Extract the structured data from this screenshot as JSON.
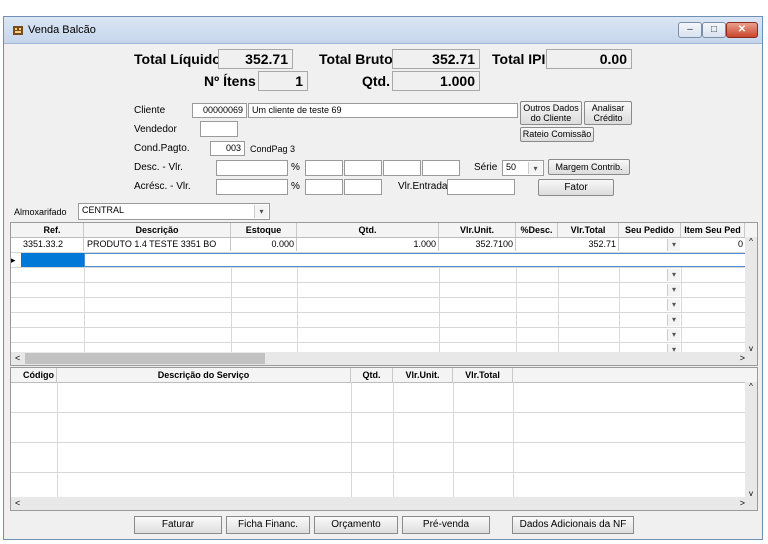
{
  "window": {
    "title": "Venda Balcão"
  },
  "totals": {
    "liquido_label": "Total Líquido",
    "liquido_value": "352.71",
    "bruto_label": "Total Bruto",
    "bruto_value": "352.71",
    "ipi_label": "Total IPI",
    "ipi_value": "0.00",
    "itens_label": "Nº Ítens",
    "itens_value": "1",
    "qtd_label": "Qtd.",
    "qtd_value": "1.000"
  },
  "form": {
    "cliente_label": "Cliente",
    "cliente_code": "00000069",
    "cliente_name": "Um cliente de teste 69",
    "vendedor_label": "Vendedor",
    "vendedor_value": "",
    "condpagto_label": "Cond.Pagto.",
    "condpagto_code": "003",
    "condpagto_name": "CondPag 3",
    "desc_label": "Desc. - Vlr.",
    "acresc_label": "Acrésc. - Vlr.",
    "percent": "%",
    "serie_label": "Série",
    "serie_value": "50",
    "vlrentrada_label": "Vlr.Entrada",
    "almox_label": "Almoxarifado",
    "almox_value": "CENTRAL"
  },
  "buttons": {
    "outros_dados": "Outros Dados do Cliente",
    "analisar_credito": "Analisar Crédito",
    "rateio": "Rateio Comissão",
    "margem": "Margem Contrib.",
    "fator": "Fator"
  },
  "products": {
    "headers": [
      "Ref.",
      "Descrição",
      "Estoque",
      "Qtd.",
      "Vlr.Unit.",
      "%Desc.",
      "Vlr.Total",
      "Seu Pedido",
      "Item Seu Ped"
    ],
    "rows": [
      [
        "3351.33.2",
        "PRODUTO 1.4 TESTE 3351 BO",
        "0.000",
        "1.000",
        "352.7100",
        "",
        "352.71",
        "",
        "0"
      ]
    ]
  },
  "services": {
    "headers": [
      "Código",
      "Descrição do Serviço",
      "Qtd.",
      "Vlr.Unit.",
      "Vlr.Total"
    ]
  },
  "footer": {
    "faturar": "Faturar",
    "ficha": "Ficha Financ.",
    "orcamento": "Orçamento",
    "prevenda": "Pré-venda",
    "dados_nf": "Dados Adicionais da NF"
  },
  "icons": {
    "dropdown": "▾",
    "scroll_left": "<",
    "scroll_right": ">",
    "scroll_up": "^",
    "scroll_down": "v",
    "row_pointer": "▸"
  }
}
